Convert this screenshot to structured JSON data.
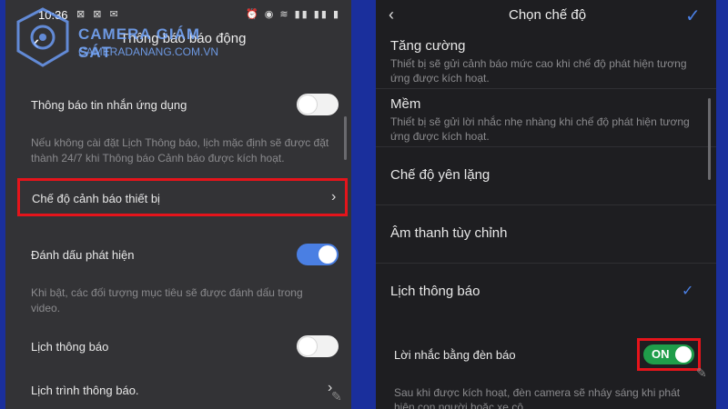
{
  "watermark": {
    "line1": "CAMERA GIÁM SÁT",
    "line2": "CAMERADANANG.COM.VN"
  },
  "left_screen": {
    "status_bar": {
      "time": "10:36",
      "left_icons": "⊠ ⊠ ✉",
      "right_icons": "⏰ ◉ ≋ ▮▮ ▮▮ ▮"
    },
    "back_icon": "‹",
    "title": "Thông báo báo động",
    "rows": [
      {
        "label": "Thông báo tin nhắn ứng dụng",
        "toggle": "off"
      },
      {
        "description": "Nếu không cài đặt Lịch Thông báo, lịch mặc định sẽ được đặt thành 24/7 khi Thông báo Cảnh báo được kích hoạt."
      },
      {
        "label": "Chế độ cảnh báo thiết bị",
        "chevron": "›",
        "highlighted": true
      },
      {
        "label": "Đánh dấu phát hiện",
        "toggle": "on"
      },
      {
        "description": "Khi bật, các đối tượng mục tiêu sẽ được đánh dấu trong video."
      },
      {
        "label": "Lịch thông báo",
        "toggle": "off"
      },
      {
        "label": "Lịch trình thông báo.",
        "chevron": "›"
      }
    ]
  },
  "right_screen": {
    "back_icon": "‹",
    "title": "Chọn chế độ",
    "confirm_icon": "✓",
    "modes": [
      {
        "title": "Tăng cường",
        "description": "Thiết bị sẽ gửi cảnh báo mức cao khi chế độ phát hiện tương ứng được kích hoạt."
      },
      {
        "title": "Mềm",
        "description": "Thiết bị sẽ gửi lời nhắc nhẹ nhàng khi chế độ phát hiện tương ứng được kích hoạt."
      },
      {
        "title": "Chế độ yên lặng"
      },
      {
        "title": "Âm thanh tùy chỉnh"
      },
      {
        "title": "Lịch thông báo",
        "selected": true
      }
    ],
    "selected_check": "✓",
    "light_reminder": {
      "label": "Lời nhắc bằng đèn báo",
      "toggle_text": "ON",
      "state": "on"
    },
    "footer_description": "Sau khi được kích hoạt, đèn camera sẽ nháy sáng khi phát hiện con người hoặc xe cộ."
  },
  "colors": {
    "accent_blue": "#4a7fe3",
    "highlight_red": "#e5141b",
    "on_green": "#1f9d4a",
    "frame_blue": "#1a2f9c"
  }
}
